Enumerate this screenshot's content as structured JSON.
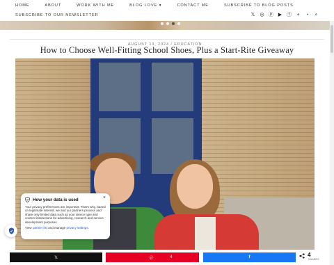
{
  "nav": {
    "row1": [
      "HOME",
      "ABOUT",
      "WORK WITH ME",
      "BLOG LOVE ▾",
      "CONTACT ME",
      "SUBSCRIBE TO BLOG POSTS"
    ],
    "row2": [
      "SUBSCRIBE TO OUR NEWSLETTER"
    ],
    "social_icons": [
      "x-icon",
      "instagram-icon",
      "pinterest-icon",
      "youtube-icon",
      "facebook-icon",
      "bloglovin-icon",
      "rss-icon",
      "search-icon"
    ]
  },
  "post": {
    "meta": "AUGUST 13, 2024 / EDUCATION",
    "title": "How to Choose Well-Fitting School Shoes, Plus a Start-Rite Giveaway"
  },
  "consent": {
    "title": "How your data is used",
    "body": "Your privacy preferences are important. That's why, based on legitimate interest, we and our partners process and share only limited data such as your device type and content interactions for advertising, research and service development purposes.",
    "view_prefix": "View",
    "partner_link": "partner list",
    "and_manage": "and manage",
    "privacy_link": "privacy settings",
    "close": "×"
  },
  "share": {
    "x_label": "𝕏",
    "pinterest_count": "4",
    "facebook_label": "f",
    "total": "4",
    "total_label": "SHARES"
  },
  "colors": {
    "pinterest": "#e60023",
    "facebook": "#1877f2",
    "x": "#111111"
  }
}
